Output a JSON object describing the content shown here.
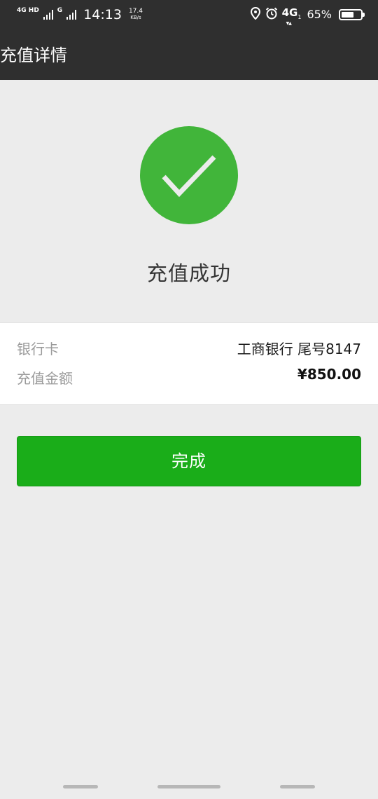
{
  "status_bar": {
    "net1_label": "4G HD",
    "net2_label": "G",
    "time": "14:13",
    "speed_value": "17.4",
    "speed_unit": "KB/s",
    "net_right": "4G",
    "net_right_sub": "1",
    "battery_percent": "65%",
    "battery_level": 0.65,
    "icons": [
      "signal-icon",
      "location-icon",
      "alarm-icon",
      "battery-icon"
    ]
  },
  "title_bar": {
    "title": "充值详情"
  },
  "result": {
    "icon": "checkmark-icon",
    "status_text": "充值成功",
    "accent_color": "#41b53a"
  },
  "details": {
    "rows": [
      {
        "label": "银行卡",
        "value": "工商银行 尾号8147"
      },
      {
        "label": "充值金额",
        "value": "¥850.00"
      }
    ]
  },
  "actions": {
    "done_label": "完成",
    "button_color": "#1aad19"
  }
}
